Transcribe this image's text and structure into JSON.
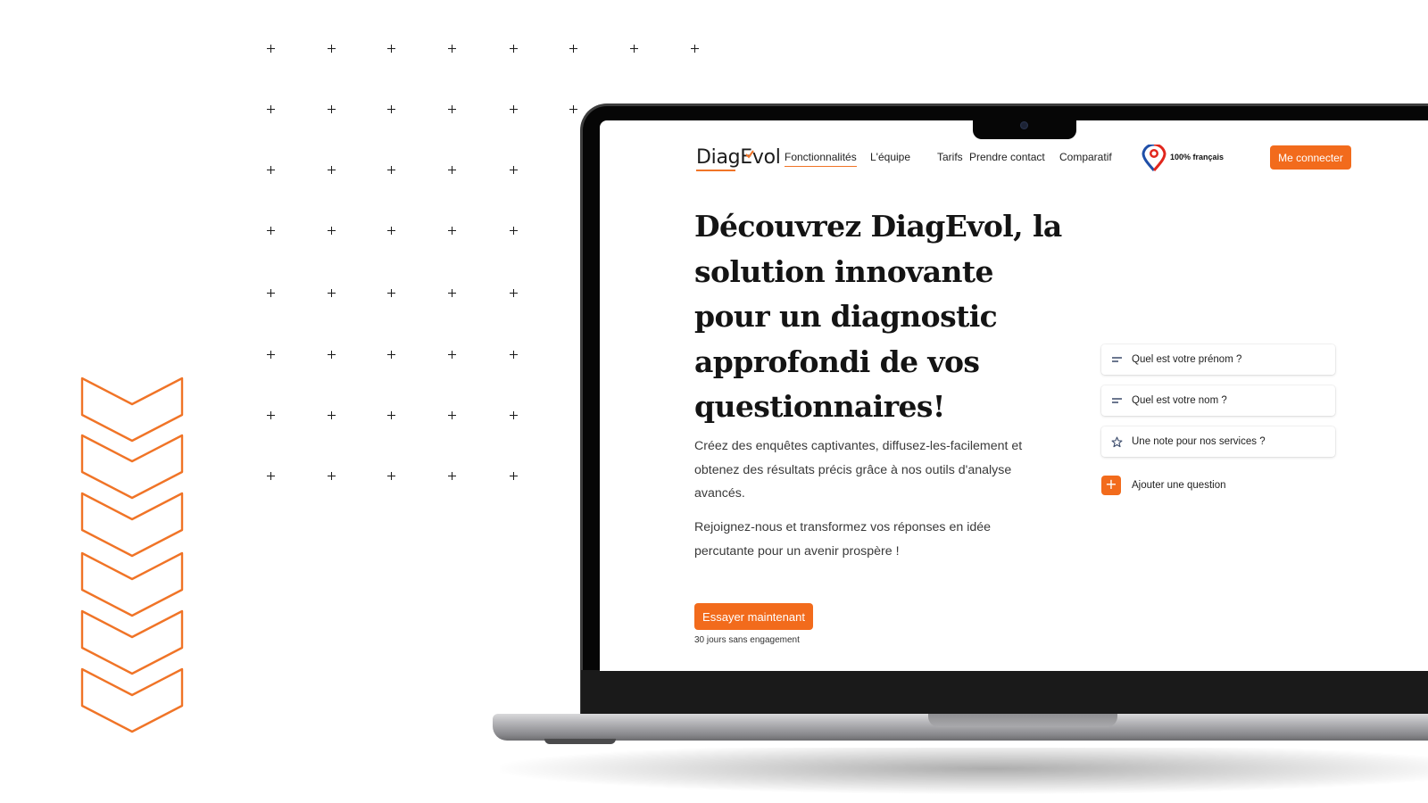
{
  "site": {
    "logo_text": "DiagEvol",
    "nav": [
      {
        "label": "Fonctionnalités",
        "active": true
      },
      {
        "label": "L'équipe"
      },
      {
        "label": "Tarifs"
      },
      {
        "label": "Prendre contact"
      },
      {
        "label": "Comparatif"
      }
    ],
    "badge": "100% français",
    "login_label": "Me connecter"
  },
  "hero": {
    "title": "Découvrez DiagEvol, la solution innovante pour un diagnostic approfondi de vos questionnaires!",
    "paragraph1": "Créez des enquêtes captivantes, diffusez-les-facilement et obtenez des résultats précis grâce à nos outils d'analyse avancés.",
    "paragraph2": "Rejoignez-nous et transformez vos réponses en idée percutante pour un avenir prospère !",
    "cta_label": "Essayer maintenant",
    "cta_note": "30 jours sans engagement"
  },
  "form_builder": {
    "questions": [
      {
        "label": "Quel est votre prénom ?",
        "icon": "short-text-icon"
      },
      {
        "label": "Quel est votre nom ?",
        "icon": "short-text-icon"
      },
      {
        "label": "Une note pour nos services ?",
        "icon": "star-icon"
      }
    ],
    "add_label": "Ajouter une question"
  },
  "colors": {
    "accent": "#f26b1c",
    "chevron": "#f07427",
    "text": "#141414"
  }
}
